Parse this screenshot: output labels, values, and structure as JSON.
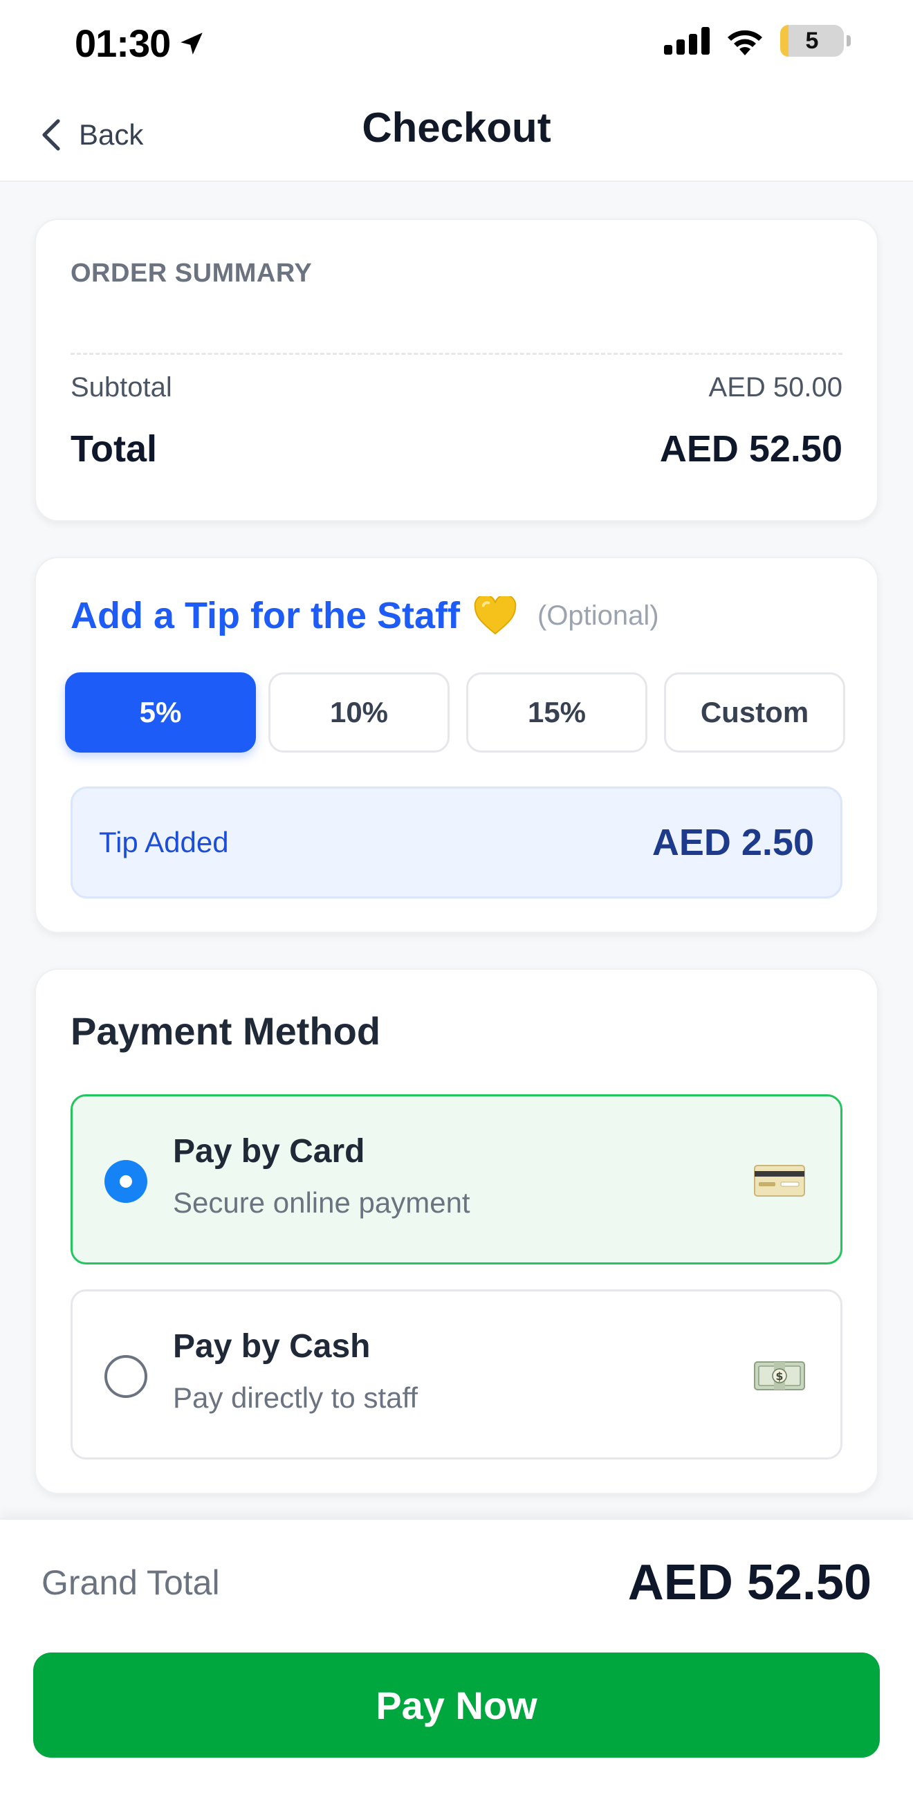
{
  "status_bar": {
    "time": "01:30",
    "battery": "5",
    "icons": [
      "location-arrow-icon",
      "signal-bars-icon",
      "wifi-icon",
      "battery-icon"
    ]
  },
  "header": {
    "back_label": "Back",
    "title": "Checkout"
  },
  "order_summary": {
    "heading": "ORDER SUMMARY",
    "subtotal_label": "Subtotal",
    "subtotal_value": "AED 50.00",
    "total_label": "Total",
    "total_value": "AED 52.50"
  },
  "tip": {
    "title": "Add a Tip for the Staff",
    "emoji_icon": "yellow-heart-icon",
    "optional_label": "(Optional)",
    "options": [
      {
        "label": "5%",
        "selected": true
      },
      {
        "label": "10%",
        "selected": false
      },
      {
        "label": "15%",
        "selected": false
      },
      {
        "label": "Custom",
        "selected": false
      }
    ],
    "added_label": "Tip Added",
    "added_value": "AED 2.50"
  },
  "payment": {
    "heading": "Payment Method",
    "options": [
      {
        "title": "Pay by Card",
        "subtitle": "Secure online payment",
        "icon": "credit-card-icon",
        "selected": true
      },
      {
        "title": "Pay by Cash",
        "subtitle": "Pay directly to staff",
        "icon": "cash-icon",
        "selected": false
      }
    ]
  },
  "footer": {
    "grand_total_label": "Grand Total",
    "grand_total_value": "AED 52.50",
    "pay_button_label": "Pay Now"
  },
  "colors": {
    "accent_blue": "#1d5cf6",
    "radio_blue": "#1582f5",
    "success_green": "#00a63e",
    "selected_option_border": "#22c55e",
    "selected_option_bg": "#eefaf1",
    "tip_added_bg": "#eef4ff"
  }
}
